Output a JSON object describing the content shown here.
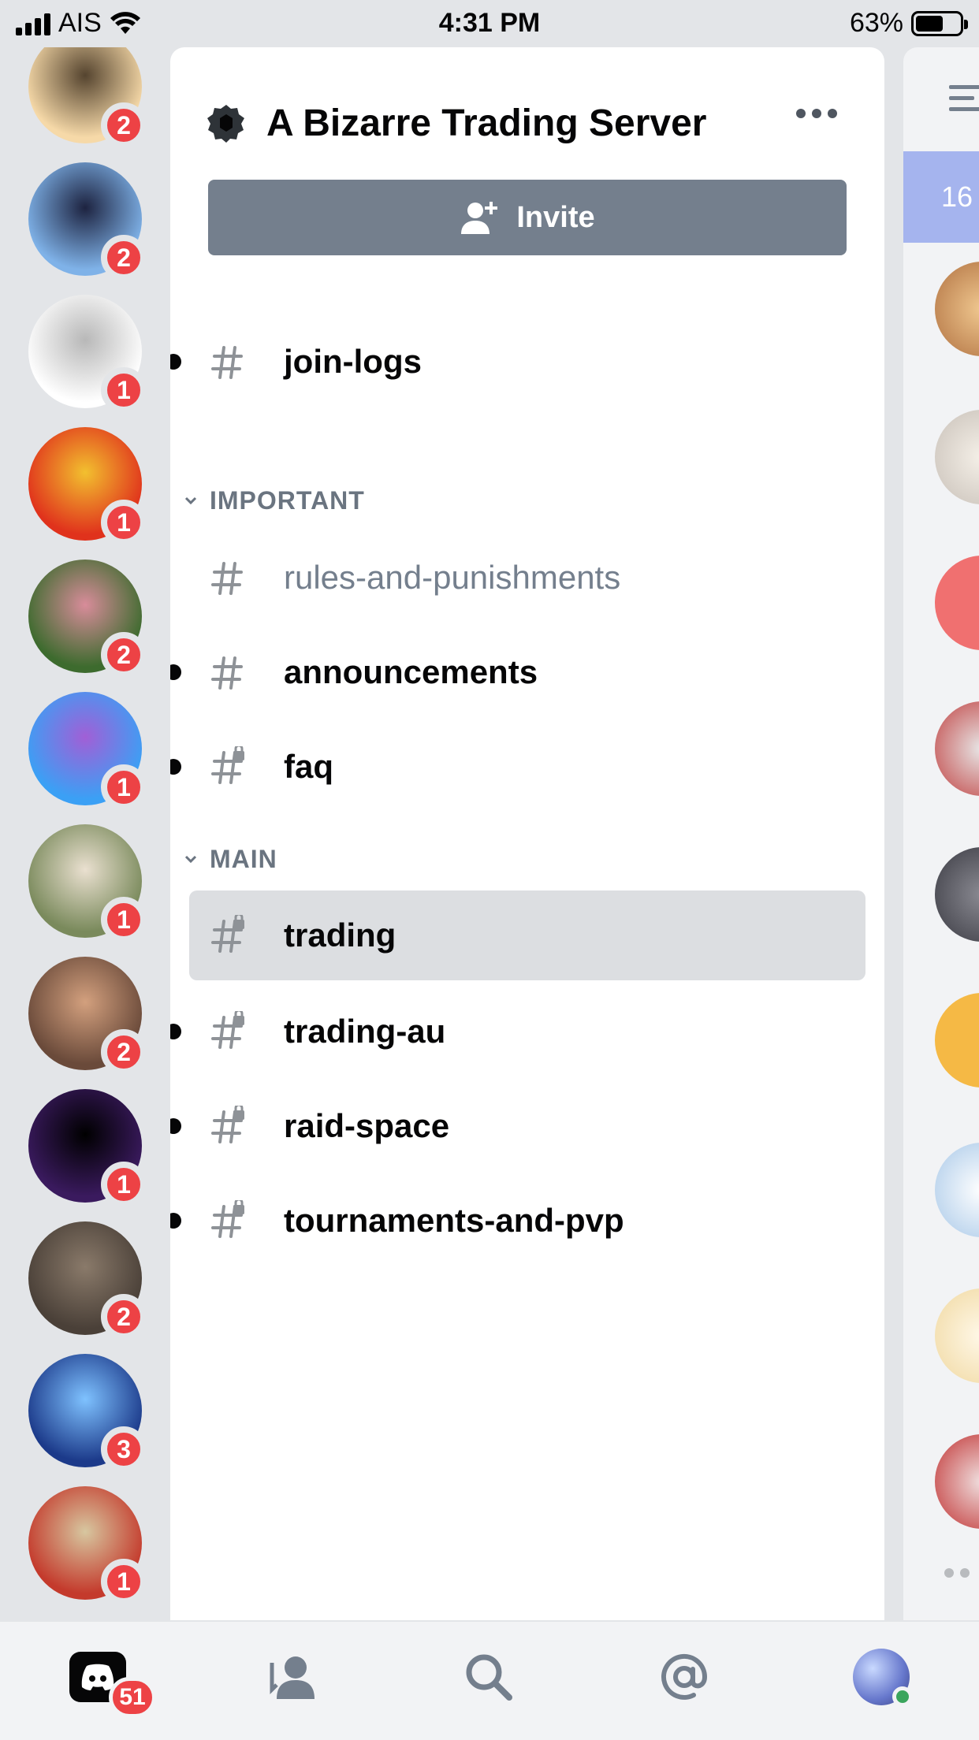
{
  "status_bar": {
    "carrier": "AIS",
    "time": "4:31 PM",
    "battery": "63%",
    "battery_level": 0.63
  },
  "servers": [
    {
      "badge": "2",
      "colors": [
        "#f6d9a8",
        "#55442f"
      ]
    },
    {
      "badge": "2",
      "colors": [
        "#7fb2e8",
        "#1d2340"
      ]
    },
    {
      "badge": "1",
      "colors": [
        "#ffffff",
        "#b8b8b8"
      ]
    },
    {
      "badge": "1",
      "colors": [
        "#e0321c",
        "#f2c02f"
      ]
    },
    {
      "badge": "2",
      "colors": [
        "#3d6b2e",
        "#d88c9a"
      ]
    },
    {
      "badge": "1",
      "colors": [
        "#3ba0f5",
        "#a15fd6"
      ]
    },
    {
      "badge": "1",
      "colors": [
        "#7a8a5c",
        "#eae0d0"
      ]
    },
    {
      "badge": "2",
      "colors": [
        "#6a4a3a",
        "#d3a07e"
      ]
    },
    {
      "badge": "1",
      "colors": [
        "#3a1a5e",
        "#000000"
      ]
    },
    {
      "badge": "2",
      "colors": [
        "#4a4038",
        "#8a7a6a"
      ]
    },
    {
      "badge": "3",
      "colors": [
        "#1c3a8a",
        "#7fc2ff"
      ]
    },
    {
      "badge": "1",
      "colors": [
        "#c43a2c",
        "#d7c7a0"
      ]
    }
  ],
  "guild": {
    "name": "A Bizarre Trading Server",
    "invite_label": "Invite"
  },
  "channels_top": [
    {
      "name": "join-logs",
      "unread": true,
      "locked": false
    }
  ],
  "categories": [
    {
      "name": "IMPORTANT",
      "channels": [
        {
          "name": "rules-and-punishments",
          "unread": false,
          "locked": false
        },
        {
          "name": "announcements",
          "unread": true,
          "locked": false
        },
        {
          "name": "faq",
          "unread": true,
          "locked": true
        }
      ]
    },
    {
      "name": "MAIN",
      "channels": [
        {
          "name": "trading",
          "unread": false,
          "locked": true,
          "selected": true
        },
        {
          "name": "trading-au",
          "unread": true,
          "locked": true
        },
        {
          "name": "raid-space",
          "unread": true,
          "locked": true
        },
        {
          "name": "tournaments-and-pvp",
          "unread": true,
          "locked": true
        }
      ]
    }
  ],
  "peek": {
    "banner_text": "16"
  },
  "tabbar": {
    "home_badge": "51"
  },
  "colors": {
    "badge_red": "#ed4245",
    "invite_gray": "#747f8d",
    "selected_bg": "#dcdee1",
    "online_green": "#3ba55d"
  }
}
